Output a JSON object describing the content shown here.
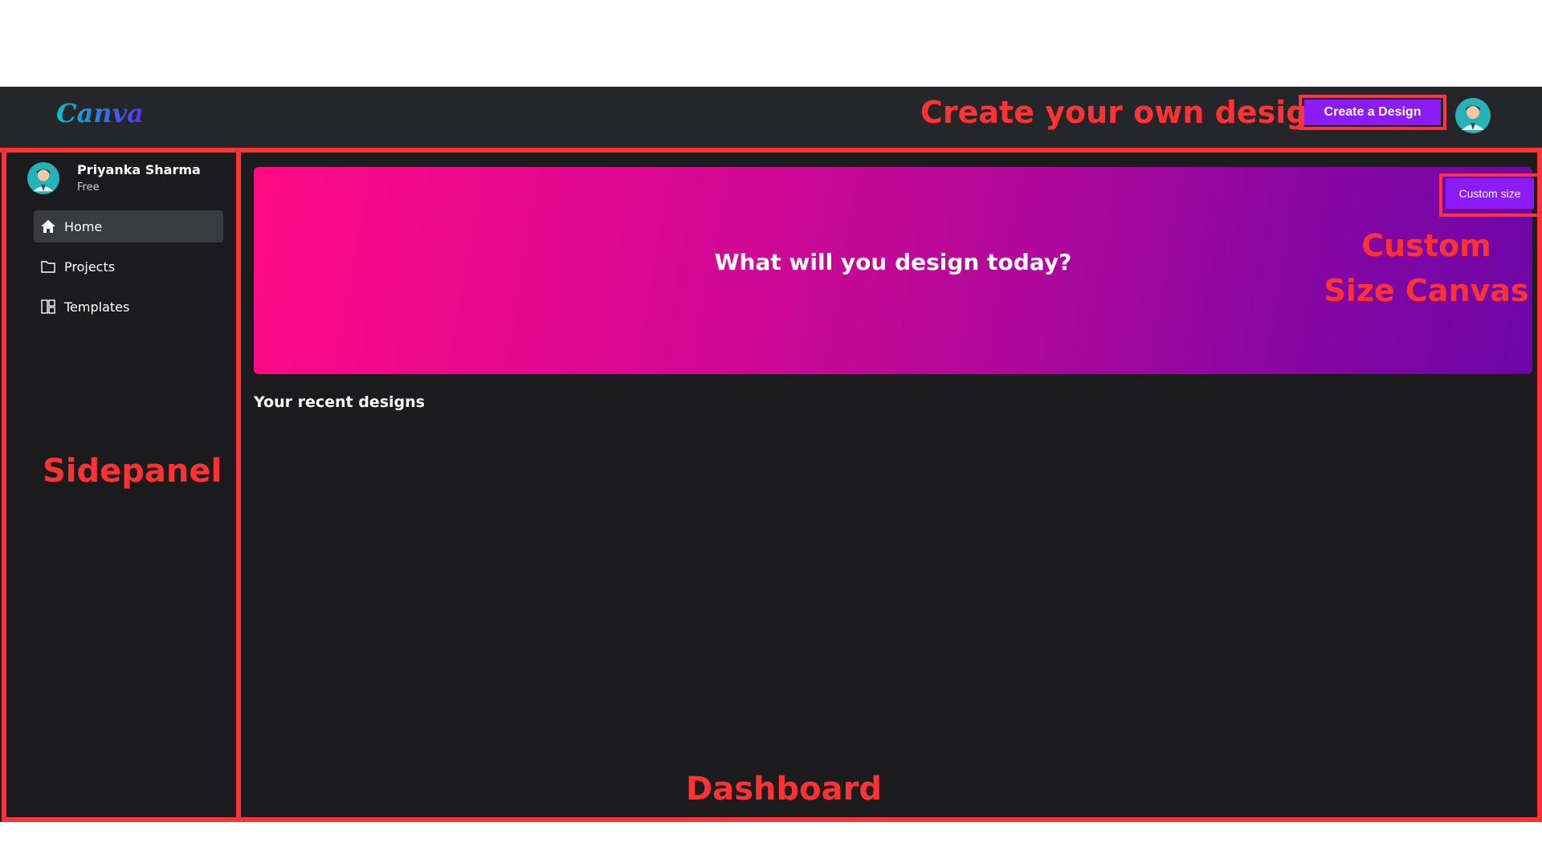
{
  "topbar": {
    "logo_text": "Canva",
    "annotation": "Create your own design",
    "create_button_label": "Create a Design",
    "avatar_icon": "user-avatar-icon"
  },
  "sidepanel": {
    "user_name": "Priyanka Sharma",
    "user_plan": "Free",
    "items": [
      {
        "label": "Home",
        "icon": "home-icon",
        "active": true
      },
      {
        "label": "Projects",
        "icon": "folder-icon",
        "active": false
      },
      {
        "label": "Templates",
        "icon": "templates-icon",
        "active": false
      }
    ],
    "annotation": "Sidepanel"
  },
  "dashboard": {
    "hero_title": "What will you design today?",
    "custom_size_label": "Custom size",
    "custom_annotation": "Custom Size Canvas",
    "recent_title": "Your recent designs",
    "annotation": "Dashboard"
  },
  "colors": {
    "annotation_red": "#ff3333",
    "accent_purple": "#8b1cf5",
    "hero_start": "#ff0a84",
    "hero_end": "#6d05a8"
  }
}
